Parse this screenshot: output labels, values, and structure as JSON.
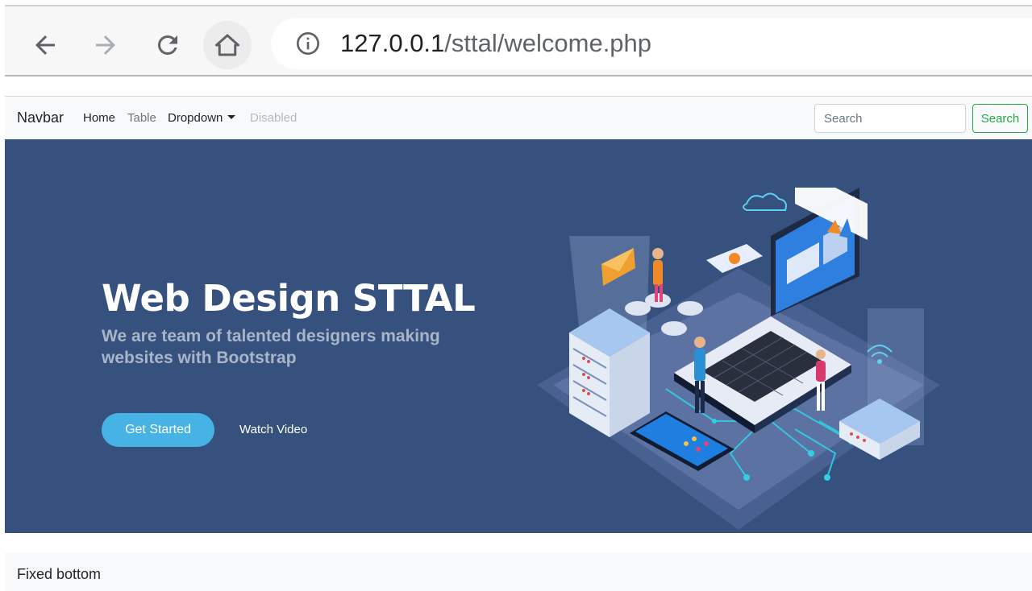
{
  "browser": {
    "url_host": "127.0.0.1",
    "url_path": "/sttal/welcome.php",
    "icons": [
      "back-arrow-icon",
      "forward-arrow-icon",
      "reload-icon",
      "home-icon",
      "info-icon"
    ]
  },
  "navbar": {
    "brand": "Navbar",
    "links": [
      {
        "label": "Home",
        "state": "active"
      },
      {
        "label": "Table",
        "state": "normal"
      },
      {
        "label": "Dropdown",
        "state": "dropdown"
      },
      {
        "label": "Disabled",
        "state": "disabled"
      }
    ],
    "search": {
      "placeholder": "Search",
      "value": "",
      "button_label": "Search"
    }
  },
  "hero": {
    "title": "Web Design STTAL",
    "subtitle": "We are team of talented designers making websites with Bootstrap",
    "primary_button": "Get Started",
    "secondary_button": "Watch Video",
    "illustration": "isometric-laptop-server-illustration"
  },
  "footer": {
    "text": "Fixed bottom"
  },
  "colors": {
    "hero_bg": "#37517e",
    "accent": "#47b2e4",
    "success": "#28a745",
    "navbar_bg": "#f8f9fa",
    "subtitle": "#a9b5c8"
  }
}
